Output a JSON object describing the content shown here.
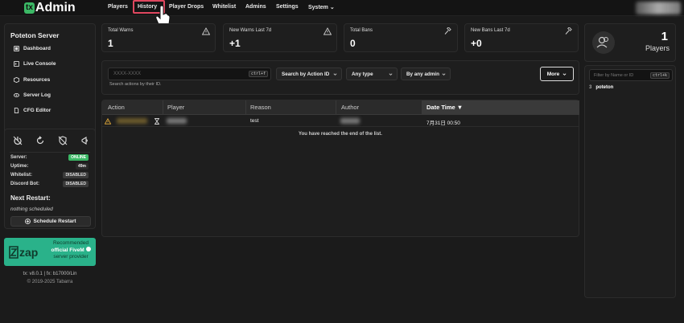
{
  "brand": {
    "prefix": "tx",
    "name": "Admin"
  },
  "nav": {
    "items": [
      "Players",
      "History",
      "Player Drops",
      "Whitelist",
      "Admins",
      "Settings",
      "System"
    ],
    "active": "History"
  },
  "sidebar": {
    "server_name": "Poteton Server",
    "menu": [
      {
        "label": "Dashboard",
        "icon": "dashboard-icon"
      },
      {
        "label": "Live Console",
        "icon": "console-icon"
      },
      {
        "label": "Resources",
        "icon": "box-icon"
      },
      {
        "label": "Server Log",
        "icon": "eye-icon"
      },
      {
        "label": "CFG Editor",
        "icon": "file-icon"
      }
    ]
  },
  "control": {
    "icons": [
      "power-icon",
      "restart-icon",
      "shield-off-icon",
      "megaphone-icon"
    ],
    "stats": [
      {
        "label": "Server:",
        "value": "ONLINE",
        "kind": "on"
      },
      {
        "label": "Uptime:",
        "value": "49m",
        "kind": "plain"
      },
      {
        "label": "Whitelist:",
        "value": "DISABLED",
        "kind": "dis"
      },
      {
        "label": "Discord Bot:",
        "value": "DISABLED",
        "kind": "dis"
      }
    ],
    "next_restart_title": "Next Restart:",
    "next_restart_value": "nothing scheduled",
    "schedule_button": "Schedule Restart"
  },
  "promo": {
    "line1": "Recommended",
    "line2": "official FiveM",
    "line3": "server provider",
    "logo": "zap"
  },
  "footer": {
    "version": "tx: v8.0.1 | fx: b17000/Lin",
    "copyright": "© 2019-2025 Tabarra"
  },
  "stat_cards": [
    {
      "title": "Total Warns",
      "value": "1",
      "icon": "warning-icon"
    },
    {
      "title": "New Warns Last 7d",
      "value": "+1",
      "icon": "warning-icon"
    },
    {
      "title": "Total Bans",
      "value": "0",
      "icon": "gavel-icon"
    },
    {
      "title": "New Bans Last 7d",
      "value": "+0",
      "icon": "gavel-icon"
    }
  ],
  "filters": {
    "search_placeholder": "XXXX-XXXX",
    "search_shortcut": "ctrl+f",
    "search_hint": "Search actions by their ID.",
    "search_by": "Search by Action ID",
    "type": "Any type",
    "admin": "By any admin",
    "more": "More"
  },
  "table": {
    "columns": [
      "Action",
      "Player",
      "Reason",
      "Author",
      "Date Time ▼"
    ],
    "rows": [
      {
        "action_icon": "warning-icon",
        "player_icon": "hourglass-icon",
        "reason": "test",
        "datetime": "7月31日 00:50"
      }
    ],
    "end_message": "You have reached the end of the list."
  },
  "players_panel": {
    "count": "1",
    "label": "Players",
    "filter_placeholder": "Filter by Name or ID",
    "filter_shortcut": "ctrl+k",
    "list": [
      {
        "id": "3",
        "name": "poteton"
      }
    ]
  }
}
